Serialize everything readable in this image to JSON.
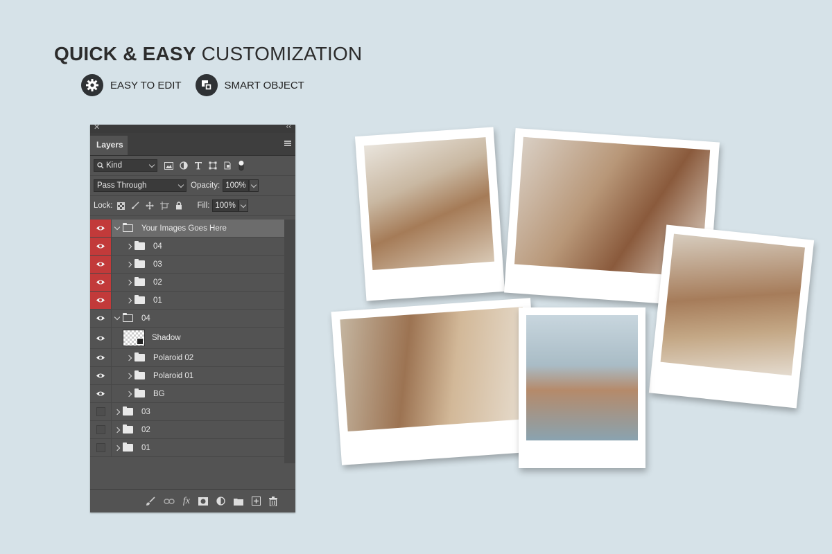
{
  "header": {
    "title_bold": "QUICK & EASY",
    "title_light": "CUSTOMIZATION",
    "features": [
      {
        "icon": "gear-icon",
        "label": "EASY TO EDIT"
      },
      {
        "icon": "smart-object-icon",
        "label": "SMART OBJECT"
      }
    ]
  },
  "panel": {
    "tab": "Layers",
    "filter_kind": "Kind",
    "blend_mode": "Pass Through",
    "opacity_label": "Opacity:",
    "opacity_value": "100%",
    "lock_label": "Lock:",
    "fill_label": "Fill:",
    "fill_value": "100%",
    "layers": [
      {
        "name": "Your Images Goes Here",
        "visible": true,
        "highlight": true,
        "selected": true,
        "indent": 0,
        "open": true,
        "type": "group"
      },
      {
        "name": "04",
        "visible": true,
        "highlight": true,
        "indent": 1,
        "type": "group"
      },
      {
        "name": "03",
        "visible": true,
        "highlight": true,
        "indent": 1,
        "type": "group"
      },
      {
        "name": "02",
        "visible": true,
        "highlight": true,
        "indent": 1,
        "type": "group"
      },
      {
        "name": "01",
        "visible": true,
        "highlight": true,
        "indent": 1,
        "type": "group"
      },
      {
        "name": "04",
        "visible": true,
        "indent": 0,
        "open": true,
        "type": "group"
      },
      {
        "name": "Shadow",
        "visible": true,
        "indent": 1,
        "type": "smart-object"
      },
      {
        "name": "Polaroid 02",
        "visible": true,
        "indent": 1,
        "type": "group"
      },
      {
        "name": "Polaroid 01",
        "visible": true,
        "indent": 1,
        "type": "group"
      },
      {
        "name": "BG",
        "visible": true,
        "indent": 1,
        "type": "group"
      },
      {
        "name": "03",
        "visible": false,
        "indent": 0,
        "type": "group"
      },
      {
        "name": "02",
        "visible": false,
        "indent": 0,
        "type": "group"
      },
      {
        "name": "01",
        "visible": false,
        "indent": 0,
        "type": "group"
      }
    ],
    "footer_icons": [
      "link-icon",
      "fx-icon",
      "mask-icon",
      "adjustment-icon",
      "folder-icon",
      "new-layer-icon",
      "trash-icon"
    ]
  },
  "colors": {
    "background": "#d6e2e8",
    "panel": "#535353",
    "visibility_highlight": "#c23a3a"
  }
}
